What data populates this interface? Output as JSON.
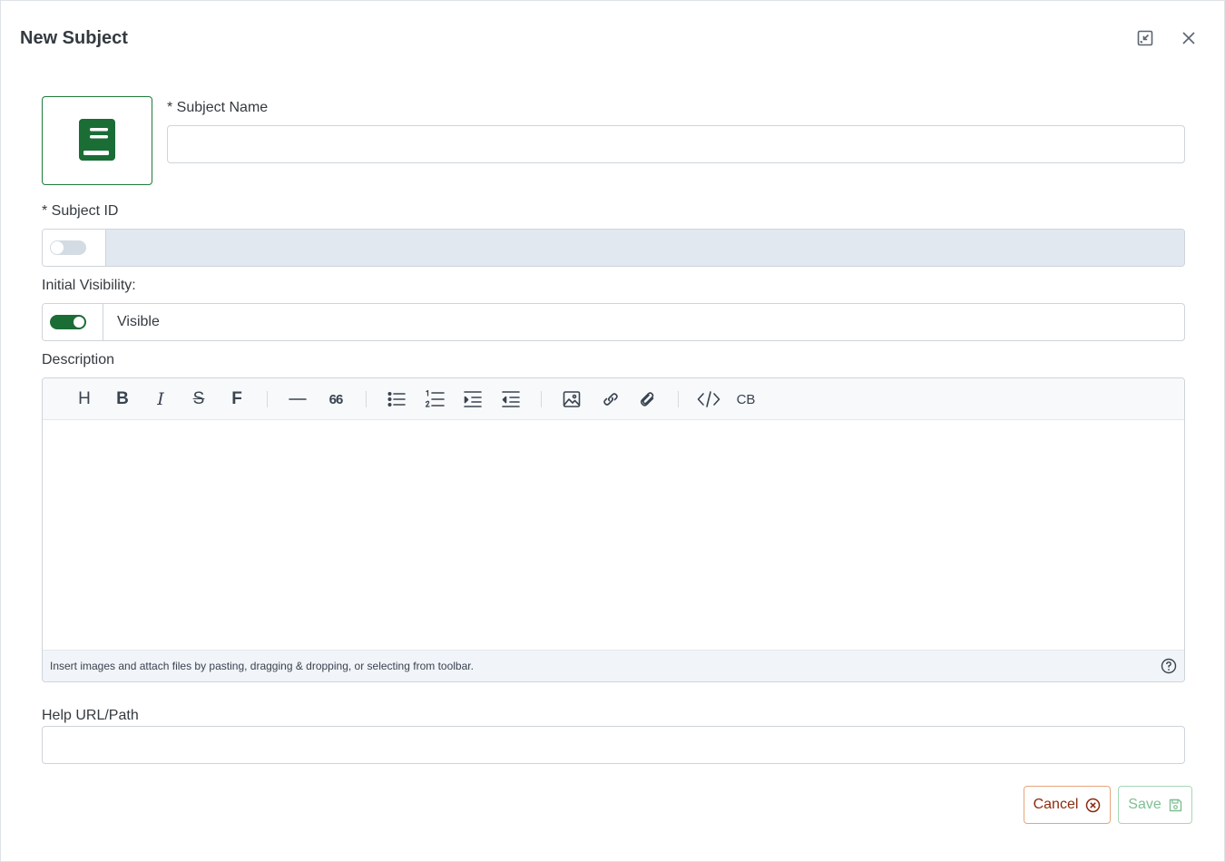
{
  "dialog": {
    "title": "New Subject"
  },
  "form": {
    "subject_name": {
      "label": "* Subject Name",
      "value": ""
    },
    "subject_id": {
      "label": "* Subject ID",
      "toggle_on": false,
      "value": ""
    },
    "initial_visibility": {
      "label": "Initial Visibility:",
      "toggle_on": true,
      "value": "Visible"
    },
    "description": {
      "label": "Description",
      "toolbar": {
        "heading": "H",
        "bold": "B",
        "italic": "I",
        "strikethrough": "S",
        "font": "F",
        "quote": "66",
        "code_block": "CB"
      },
      "footer_hint": "Insert images and attach files by pasting, dragging & dropping, or selecting from toolbar."
    },
    "help_url": {
      "label": "Help URL/Path",
      "value": ""
    }
  },
  "actions": {
    "cancel": "Cancel",
    "save": "Save"
  },
  "colors": {
    "brand_green": "#1b6d36",
    "cancel_text": "#8a2b0e",
    "cancel_border": "#e7a57a",
    "save_text": "#7fbf93",
    "disabled_field": "#e2e8f0"
  },
  "icons": [
    "book-icon",
    "minimize-icon",
    "close-icon",
    "help-circle-icon",
    "cancel-circle-icon",
    "save-disk-icon"
  ]
}
